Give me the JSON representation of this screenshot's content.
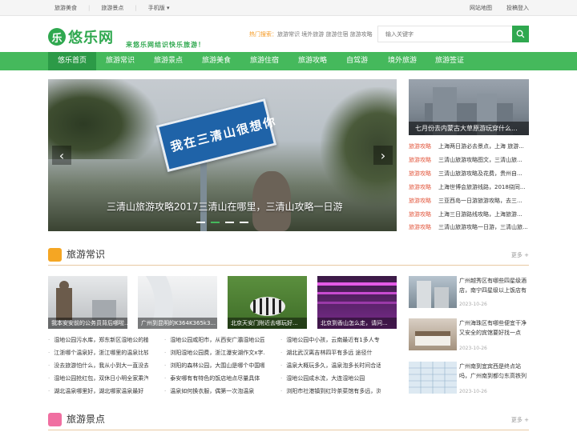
{
  "topbar": {
    "left": [
      "旅游美食",
      "旅游景点",
      "手机版"
    ],
    "right": [
      "网站地图",
      "投稿登入"
    ]
  },
  "header": {
    "logo_glyph": "乐",
    "logo_text": "悠乐网",
    "slogan": "来悠乐网结识快乐旅游！",
    "hot_label": "热门搜索：",
    "hot_terms": "旅游常识 境外旅游 旅游住宿 旅游攻略",
    "search_placeholder": "输入关键字"
  },
  "nav": [
    "悠乐首页",
    "旅游常识",
    "旅游景点",
    "旅游美食",
    "旅游住宿",
    "旅游攻略",
    "自驾游",
    "境外旅游",
    "旅游签证"
  ],
  "slider": {
    "sign_text": "我在三清山很想你",
    "caption": "三清山旅游攻略2017三清山在哪里，三清山攻略一日游",
    "prev": "‹",
    "next": "›",
    "active_dot": 1,
    "dot_count": 4
  },
  "side": {
    "feature_caption": "七月份去内蒙古大草原游玩穿什么...",
    "news": [
      {
        "tag": "旅游攻略",
        "title": "上海两日游必去景点，上海 旅游..."
      },
      {
        "tag": "旅游攻略",
        "title": "三清山旅游攻略图文，三清山旅..."
      },
      {
        "tag": "旅游攻略",
        "title": "三清山旅游攻略及花费，贵州自..."
      },
      {
        "tag": "旅游攻略",
        "title": "上海世博会旅游线路，2018绕同..."
      },
      {
        "tag": "旅游攻略",
        "title": "三亚西岛一日游旅游攻略，去三..."
      },
      {
        "tag": "旅游攻略",
        "title": "上海三日游路线攻略，上海旅游..."
      },
      {
        "tag": "旅游攻略",
        "title": "三清山旅游攻略一日游，三清山旅..."
      }
    ]
  },
  "section1": {
    "title": "旅游常识",
    "more": "更多 +",
    "thumbs": [
      {
        "caption": "我本安安前的公务员背后哪啦..."
      },
      {
        "caption": "广州到昆明的K364K365k3..."
      },
      {
        "caption": "北京天安门附近去哪玩好..."
      },
      {
        "caption": "北京到香山怎么走，请问..."
      }
    ],
    "col1": [
      "湿地公园污水库，郑东新区湿地公的植",
      "江浙哪个温泉好，浙江哪里的温泉比较",
      "没去旅游怕什么，我从小到大一直没去",
      "湿地公园抢红包，双休日小明全家乘汽",
      "湖北温泉哪里好，湖北哪家温泉最好"
    ],
    "col2": [
      "湿地公园咸阳市，从西安广灞湿地公园",
      "浏阳湿地公园费，浙江瀑安湖作文x字.",
      "浏阳的森林公园，大围山是哪个中国哪",
      "泰安哪有有特色的饭店地点尽量具体",
      "温泉如何换衣服，偶第一次泡温泉"
    ],
    "col3": [
      "湿地公园中小孩，云南最近有1多人专",
      "湖北武汉离吉林四平有多远 途径什",
      "温泉大概玩多久，温泉泡多长时间合适",
      "湿地公园成水流，大连湿地公园",
      "浏阳市社港镇到红玲茶菜馆有多远，浏"
    ],
    "right": [
      {
        "title": "广州越秀区有哪些四星级酒店，南宁四星级以上饭店有",
        "date": "2023-10-26"
      },
      {
        "title": "广州海珠区有哪些便宜干净又安全的宾馆要好找一点",
        "date": "2023-10-26"
      },
      {
        "title": "广州南到宜宾西是终点站吗，广州南到都匀东高铁列",
        "date": "2023-10-26"
      }
    ]
  },
  "section2": {
    "title": "旅游景点",
    "more": "更多 +"
  },
  "colors": {
    "brand": "#2fa84f",
    "nav": "#45b95c",
    "nav_active": "#2c9a47",
    "tag": "#e2553b",
    "hot": "#f59a23"
  }
}
